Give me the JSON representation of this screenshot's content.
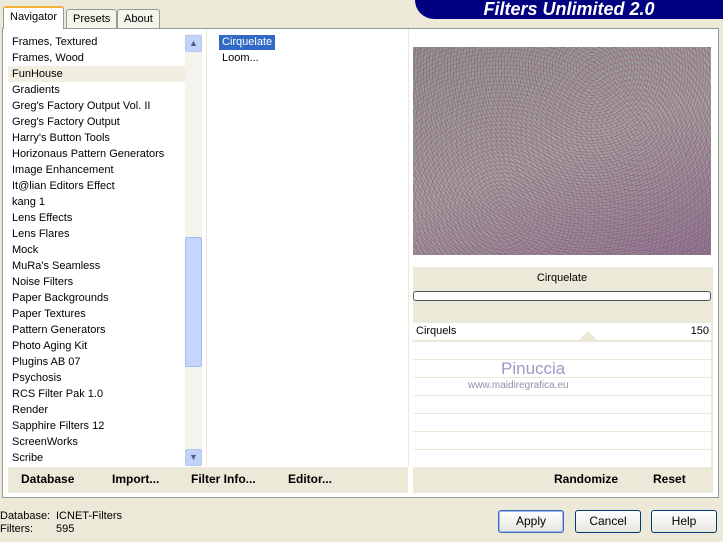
{
  "tabs": [
    "Navigator",
    "Presets",
    "About"
  ],
  "title": "Filters Unlimited 2.0",
  "categories": [
    "Frames, Textured",
    "Frames, Wood",
    "FunHouse",
    "Gradients",
    "Greg's Factory Output Vol. II",
    "Greg's Factory Output",
    "Harry's Button Tools",
    "Horizonaus Pattern Generators",
    "Image Enhancement",
    "It@lian Editors Effect",
    "kang 1",
    "Lens Effects",
    "Lens Flares",
    "Mock",
    "MuRa's Seamless",
    "Noise Filters",
    "Paper Backgrounds",
    "Paper Textures",
    "Pattern Generators",
    "Photo Aging Kit",
    "Plugins AB 07",
    "Psychosis",
    "RCS Filter Pak 1.0",
    "Render",
    "Sapphire Filters 12",
    "ScreenWorks",
    "Scribe"
  ],
  "selected_category": "FunHouse",
  "filters": [
    "Cirquelate",
    "Loom..."
  ],
  "selected_filter": "Cirquelate",
  "filter_name": "Cirquelate",
  "param": {
    "label": "Cirquels",
    "value": "150"
  },
  "watermark": {
    "name": "Pinuccia",
    "url": "www.maidiregrafica.eu"
  },
  "bottom_buttons": {
    "database": "Database",
    "import": "Import...",
    "filter_info": "Filter Info...",
    "editor": "Editor...",
    "randomize": "Randomize",
    "reset": "Reset"
  },
  "status": {
    "db_label": "Database:",
    "db_value": "ICNET-Filters",
    "filters_label": "Filters:",
    "filters_value": "595"
  },
  "dialog": {
    "apply": "Apply",
    "cancel": "Cancel",
    "help": "Help"
  }
}
